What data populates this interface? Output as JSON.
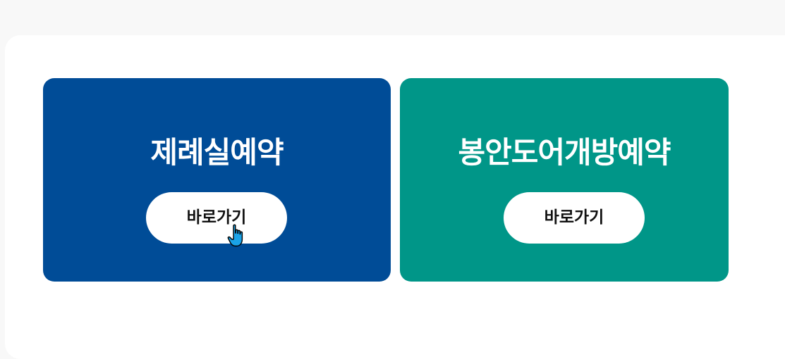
{
  "cards": [
    {
      "title": "제례실예약",
      "button_label": "바로가기",
      "color": "#004C97"
    },
    {
      "title": "봉안도어개방예약",
      "button_label": "바로가기",
      "color": "#009688"
    }
  ],
  "cursor": {
    "icon": "hand-pointer-icon",
    "color": "#1AA3E8"
  }
}
